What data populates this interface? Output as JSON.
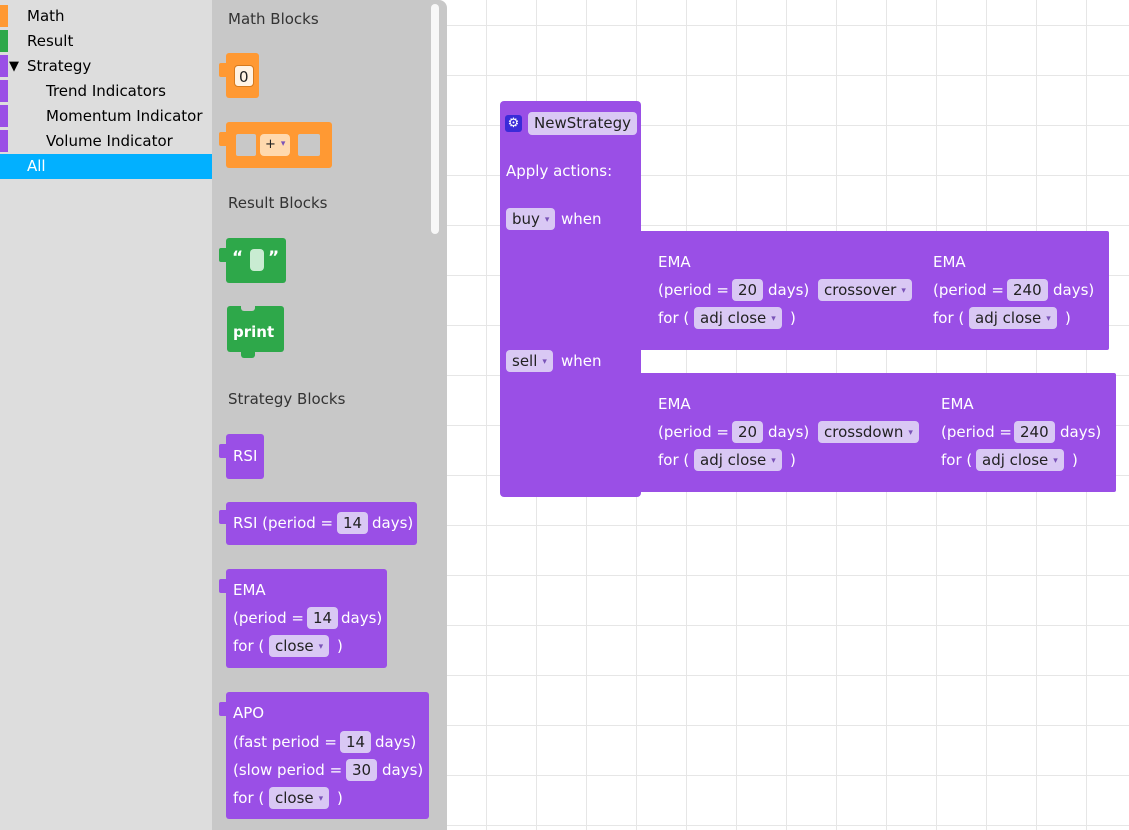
{
  "toolbox": {
    "categories": [
      {
        "label": "Math",
        "color": "#ff9933"
      },
      {
        "label": "Result",
        "color": "#2ea84a"
      },
      {
        "label": "Strategy",
        "color": "#9a4fe6",
        "expanded_icon": "▼"
      },
      {
        "label": "Trend Indicators",
        "color": "#9a4fe6"
      },
      {
        "label": "Momentum Indicator",
        "color": "#9a4fe6"
      },
      {
        "label": "Volume Indicator",
        "color": "#9a4fe6"
      },
      {
        "label": "All",
        "selected": true
      }
    ]
  },
  "flyout": {
    "math_title": "Math Blocks",
    "number_value": "0",
    "operator": "+",
    "result_title": "Result Blocks",
    "quote_open": "“",
    "quote_close": "”",
    "print_label": "print",
    "strategy_title": "Strategy Blocks",
    "rsi_label": "RSI",
    "rsi_period": {
      "prefix": "RSI (period =",
      "value": "14",
      "suffix": "days)"
    },
    "ema": {
      "title": "EMA",
      "prefix": "(period =",
      "value": "14",
      "suffix": "days)",
      "for": "for (",
      "source": "close",
      "close_paren": ")"
    },
    "apo": {
      "title": "APO",
      "fast_prefix": "(fast period =",
      "fast_value": "14",
      "slow_prefix": "(slow period =",
      "slow_value": "30",
      "suffix": "days)",
      "for": "for (",
      "source": "close",
      "close_paren": ")"
    }
  },
  "strategy": {
    "name": "NewStrategy",
    "gear_icon": "gear-icon",
    "apply_label": "Apply actions:",
    "when_label": "when",
    "buy": {
      "action": "buy",
      "left": {
        "title": "EMA",
        "prefix": "(period =",
        "value": "20",
        "suffix": "days)",
        "for": "for (",
        "source": "adj close",
        "close_paren": ")"
      },
      "operator": "crossover",
      "right": {
        "title": "EMA",
        "prefix": "(period =",
        "value": "240",
        "suffix": "days)",
        "for": "for (",
        "source": "adj close",
        "close_paren": ")"
      }
    },
    "sell": {
      "action": "sell",
      "left": {
        "title": "EMA",
        "prefix": "(period =",
        "value": "20",
        "suffix": "days)",
        "for": "for (",
        "source": "adj close",
        "close_paren": ")"
      },
      "operator": "crossdown",
      "right": {
        "title": "EMA",
        "prefix": "(period =",
        "value": "240",
        "suffix": "days)",
        "for": "for (",
        "source": "adj close",
        "close_paren": ")"
      }
    }
  },
  "colors": {
    "math": "#ff9933",
    "result": "#2ea84a",
    "strategy": "#9a4fe6",
    "selected": "#02b0ff"
  }
}
